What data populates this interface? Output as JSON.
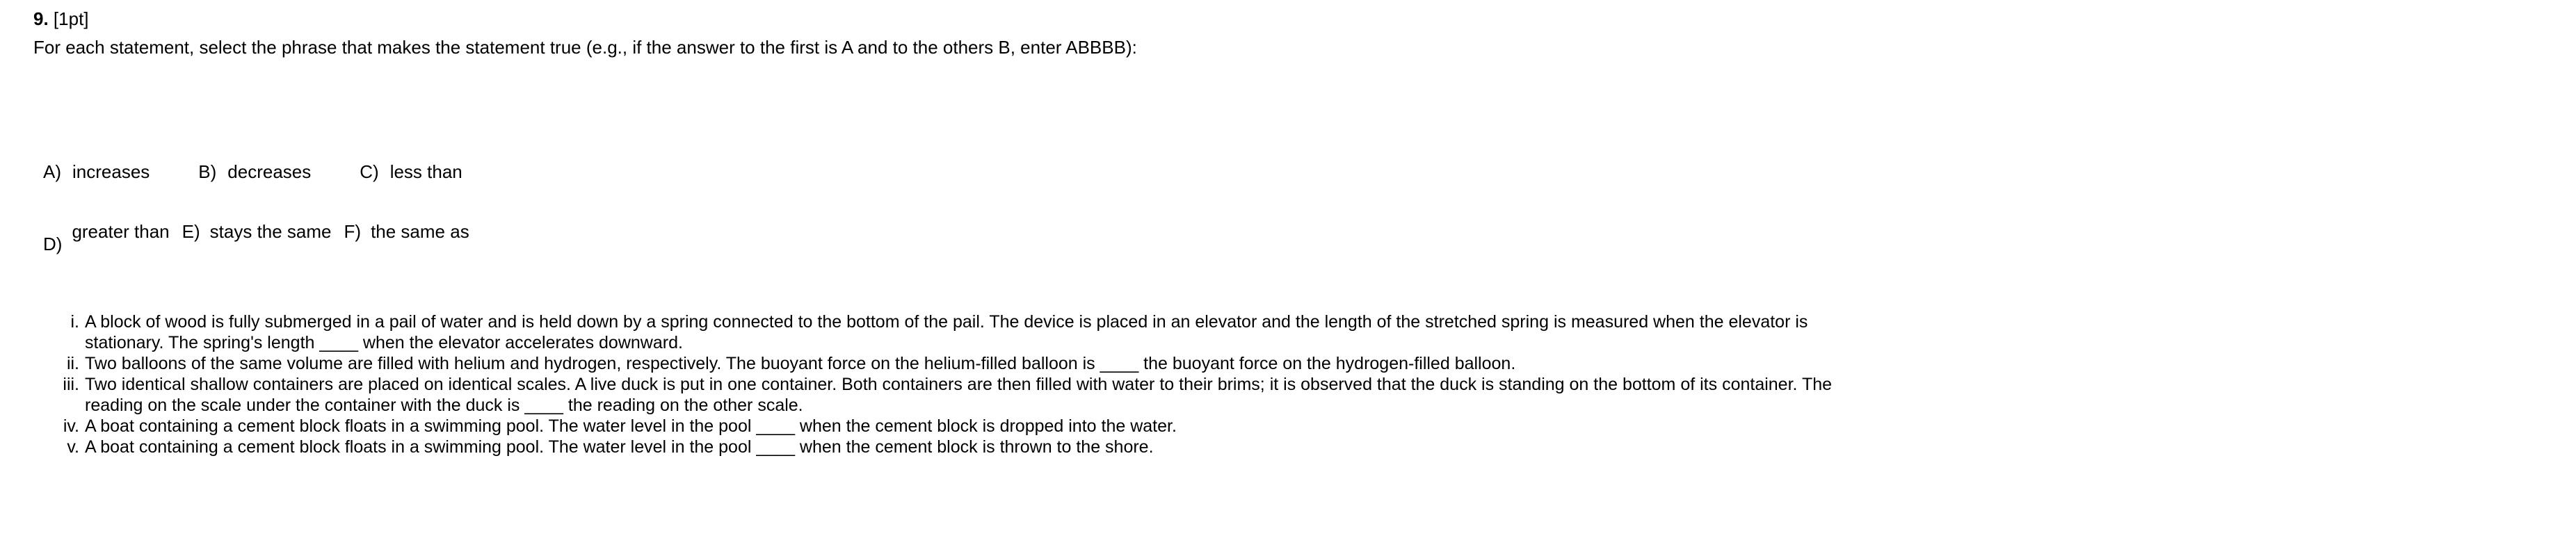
{
  "question": {
    "number": "9.",
    "points": "[1pt]",
    "instruction": "For each statement, select the phrase that makes the statement true (e.g., if the answer to the first is A and to the others B, enter ABBBB):"
  },
  "options": {
    "row1": [
      {
        "letter": "A)",
        "text": "increases"
      },
      {
        "letter": "B)",
        "text": "decreases"
      },
      {
        "letter": "C)",
        "text": "less than"
      }
    ],
    "row2": [
      {
        "letter": "D)",
        "text": "greater than"
      },
      {
        "letter": "E)",
        "text": "stays the same"
      },
      {
        "letter": "F)",
        "text": "the same as"
      }
    ]
  },
  "statements": [
    {
      "marker": "i.",
      "lines": [
        "A block of wood is fully submerged in a pail of water and is held down by a spring connected to the bottom of the pail. The device is placed in an elevator and the length of the stretched spring is measured when the elevator is",
        "stationary. The spring's length ____ when the elevator accelerates downward."
      ]
    },
    {
      "marker": "ii.",
      "lines": [
        "Two balloons of the same volume are filled with helium and hydrogen, respectively. The buoyant force on the helium-filled balloon is ____ the buoyant force on the hydrogen-filled balloon."
      ]
    },
    {
      "marker": "iii.",
      "lines": [
        "Two identical shallow containers are placed on identical scales. A live duck is put in one container. Both containers are then filled with water to their brims; it is observed that the duck is standing on the bottom of its container. The",
        "reading on the scale under the container with the duck is ____ the reading on the other scale."
      ]
    },
    {
      "marker": "iv.",
      "lines": [
        "A boat containing a cement block floats in a swimming pool. The water level in the pool ____ when the cement block is dropped into the water."
      ]
    },
    {
      "marker": "v.",
      "lines": [
        "A boat containing a cement block floats in a swimming pool. The water level in the pool ____ when the cement block is thrown to the shore."
      ]
    }
  ]
}
